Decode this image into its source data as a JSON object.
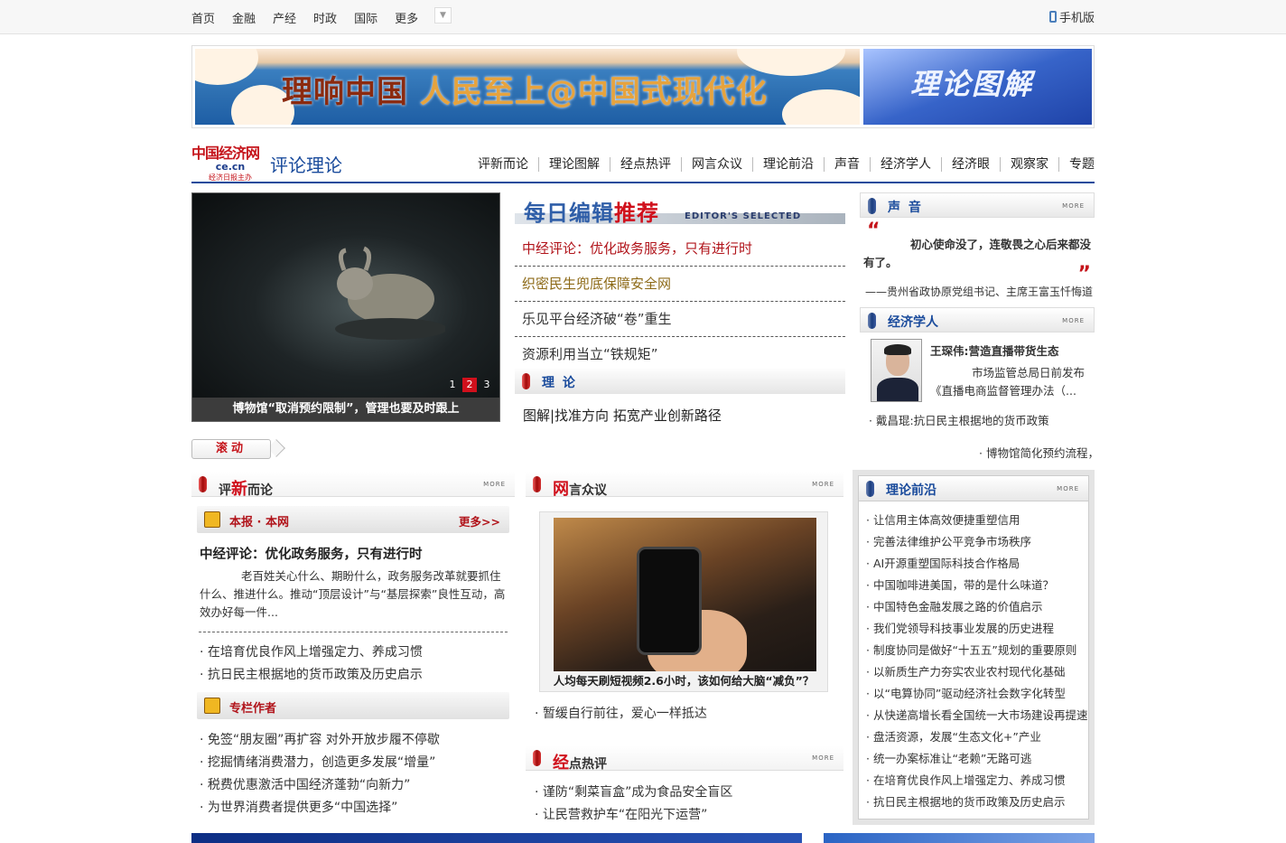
{
  "topnav": {
    "items": [
      "首页",
      "金融",
      "产经",
      "时政",
      "国际",
      "更多"
    ],
    "mobile": "手机版"
  },
  "banner": {
    "slogan_prefix": "理响中国",
    "slogan_main": "人民至上@中国式现代化",
    "side_text": "理论图解"
  },
  "header": {
    "logo_cn": "中国经济网",
    "logo_domain": "ce.cn",
    "logo_sub": "经济日报主办",
    "section_title": "评论理论",
    "subnav": [
      "评新而论",
      "理论图解",
      "经点热评",
      "网言众议",
      "理论前沿",
      "声音",
      "经济学人",
      "经济眼",
      "观察家",
      "专题"
    ]
  },
  "slider": {
    "caption": "博物馆“取消预约限制”，管理也要及时跟上",
    "pages": [
      "1",
      "2",
      "3"
    ],
    "active_page": "2"
  },
  "editor": {
    "title_a": "每日编辑",
    "title_b": "推荐",
    "title_en": "EDITOR'S SELECTED",
    "items": [
      "中经评论：优化政务服务，只有进行时",
      "织密民生兜底保障安全网",
      "乐见平台经济破“卷”重生",
      "资源利用当立“铁规矩”"
    ]
  },
  "theory": {
    "title": "理  论",
    "link": "图解|找准方向  拓宽产业创新路径"
  },
  "voice": {
    "title": "声  音",
    "more": "MORE",
    "quote": "初心使命没了，连敬畏之心后来都没有了。",
    "source": "——贵州省政协原党组书记、主席王富玉忏悔道"
  },
  "economist": {
    "title": "经济学人",
    "more": "MORE",
    "headline": "王琛伟:营造直播带货生态",
    "desc": "市场监管总局日前发布《直播电商监督管理办法（...",
    "link": "· 戴昌琨:抗日民主根据地的货币政策"
  },
  "scroll": {
    "tab": "滚动",
    "ticker": "· 博物馆简化预约流程，"
  },
  "commentary": {
    "title_a": "评",
    "title_b": "新",
    "title_c": "而论",
    "more": "MORE",
    "sub1": {
      "title": "本报 · 本网",
      "more": "更多>>"
    },
    "lead_title": "中经评论：优化政务服务，只有进行时",
    "lead_desc": "老百姓关心什么、期盼什么，政务服务改革就要抓住什么、推进什么。推动“顶层设计”与“基层探索”良性互动，高效办好每一件...",
    "links1": [
      "· 在培育优良作风上增强定力、养成习惯",
      "· 抗日民主根据地的货币政策及历史启示"
    ],
    "sub2": {
      "title": "专栏作者"
    },
    "links2": [
      "· 免签“朋友圈”再扩容 对外开放步履不停歇",
      "· 挖掘情绪消费潜力，创造更多发展“增量”",
      "· 税费优惠激活中国经济蓬勃“向新力”",
      "· 为世界消费者提供更多“中国选择”"
    ]
  },
  "netsay": {
    "title_a": "网",
    "title_b": "言众议",
    "more": "MORE",
    "photo_caption": "人均每天刷短视频2.6小时，该如何给大脑“减负”？",
    "links": [
      "· 暂缓自行前往，爱心一样抵达"
    ],
    "hot_title_a": "经",
    "hot_title_b": "点热评",
    "hot_links": [
      "· 谨防“剩菜盲盒”成为食品安全盲区",
      "· 让民营救护车“在阳光下运营”"
    ]
  },
  "frontier": {
    "title": "理论前沿",
    "more": "MORE",
    "links": [
      "· 让信用主体高效便捷重塑信用",
      "· 完善法律维护公平竞争市场秩序",
      "· AI开源重塑国际科技合作格局",
      "· 中国咖啡进美国，带的是什么味道？",
      "· 中国特色金融发展之路的价值启示",
      "· 我们党领导科技事业发展的历史进程",
      "· 制度协同是做好“十五五”规划的重要原则",
      "· 以新质生产力夯实农业农村现代化基础",
      "· 以“电算协同”驱动经济社会数字化转型",
      "· 从快递高增长看全国统一大市场建设再提速",
      "· 盘活资源，发展“生态文化+”产业",
      "· 统一办案标准让“老赖”无路可逃",
      "· 在培育优良作风上增强定力、养成习惯",
      "· 抗日民主根据地的货币政策及历史启示"
    ]
  },
  "colors": {
    "brand_blue": "#1a4b9c",
    "accent_red": "#c5141b"
  }
}
